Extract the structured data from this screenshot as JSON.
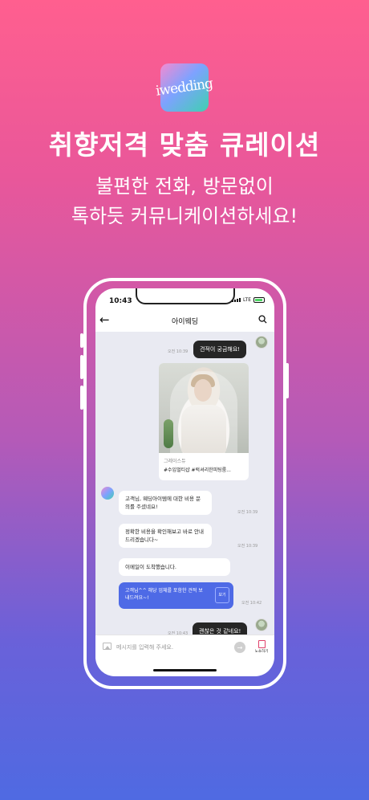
{
  "brand": {
    "logo_text": "iwedding",
    "accent": "#4e6ae6"
  },
  "headline": "취향저격 맞춤 큐레이션",
  "subline1": "불편한 전화, 방문없이",
  "subline2": "톡하듯 커뮤니케이션하세요!",
  "phone": {
    "status": {
      "time": "10:43",
      "network": "LTE"
    },
    "appbar": {
      "title": "아이웨딩",
      "back_icon": "back-arrow-icon",
      "search_icon": "search-icon"
    },
    "messages": {
      "m1": {
        "text": "견적이 궁금해요!",
        "time": "오전 10:39"
      },
      "card": {
        "shop": "그레이스듀",
        "tags": "#수입멀티샵 #럭셔리한피팅룸..."
      },
      "m2": {
        "text": "고객님, 웨딩아이템에 대한 비용 문의를 주셨네요!",
        "time": "오전 10:39"
      },
      "m3": {
        "text": "정확한 비용을 확인해보고 바로 안내드리겠습니다~",
        "time": "오전 10:39"
      },
      "m4": {
        "text": "이메일이 도착했습니다."
      },
      "m5": {
        "text": "고객님^^ 해당 업체를 포함한 견적 보내드려요~!",
        "button": "보기",
        "time": "오전 10:42"
      },
      "m6": {
        "text": "괜찮은 것 같네요!",
        "time": "오전 10:43"
      }
    },
    "input": {
      "placeholder": "메시지를 입력해 주세요.",
      "noshow_label": "노쇼하기",
      "send_icon": "send-arrow-icon"
    }
  }
}
